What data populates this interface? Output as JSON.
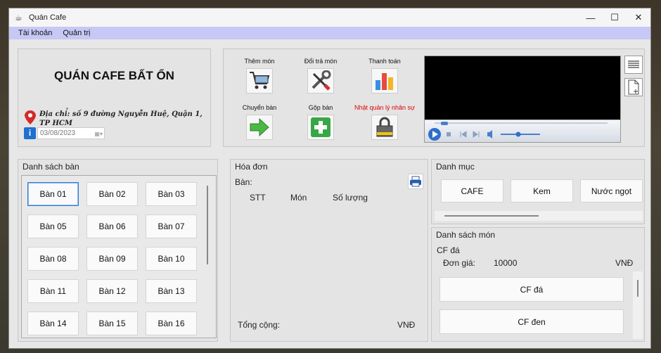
{
  "window": {
    "title": "Quán Cafe"
  },
  "menu": {
    "items": [
      "Tài khoản",
      "Quản trị"
    ]
  },
  "shop": {
    "name": "QUÁN CAFE BẤT ỔN",
    "address": "Địa chỉ: số 9 đường Nguyễn Huệ, Quận 1, TP HCM",
    "date": "03/08/2023"
  },
  "functions": {
    "add_food": "Thêm món",
    "return_food": "Đổi trả món",
    "pay": "Thanh toán",
    "move_table": "Chuyển bàn",
    "merge_table": "Gộp bàn",
    "staff_log": "Nhật quản lý nhân sự"
  },
  "tables": {
    "title": "Danh sách bàn",
    "items": [
      "Bàn 01",
      "Bàn 02",
      "Bàn 03",
      "Bàn 05",
      "Bàn 06",
      "Bàn 07",
      "Bàn 08",
      "Bàn 09",
      "Bàn 10",
      "Bàn 11",
      "Bàn 12",
      "Bàn 13",
      "Bàn 14",
      "Bàn 15",
      "Bàn 16"
    ]
  },
  "invoice": {
    "title": "Hóa đơn",
    "table_label": "Bàn:",
    "columns": [
      "STT",
      "Món",
      "Số lượng"
    ],
    "total_label": "Tổng cộng:",
    "currency": "VNĐ"
  },
  "categories": {
    "title": "Danh mục",
    "items": [
      "CAFE",
      "Kem",
      "Nước ngọt"
    ]
  },
  "foods": {
    "title": "Danh sách món",
    "selected_name": "CF đá",
    "price_label": "Đơn giá:",
    "price_value": "10000",
    "currency": "VNĐ",
    "items": [
      "CF đá",
      "CF đen"
    ]
  },
  "colors": {
    "menubar": "#c7c8f5",
    "accent": "#2f7bd3",
    "staff_label": "#e00000"
  }
}
